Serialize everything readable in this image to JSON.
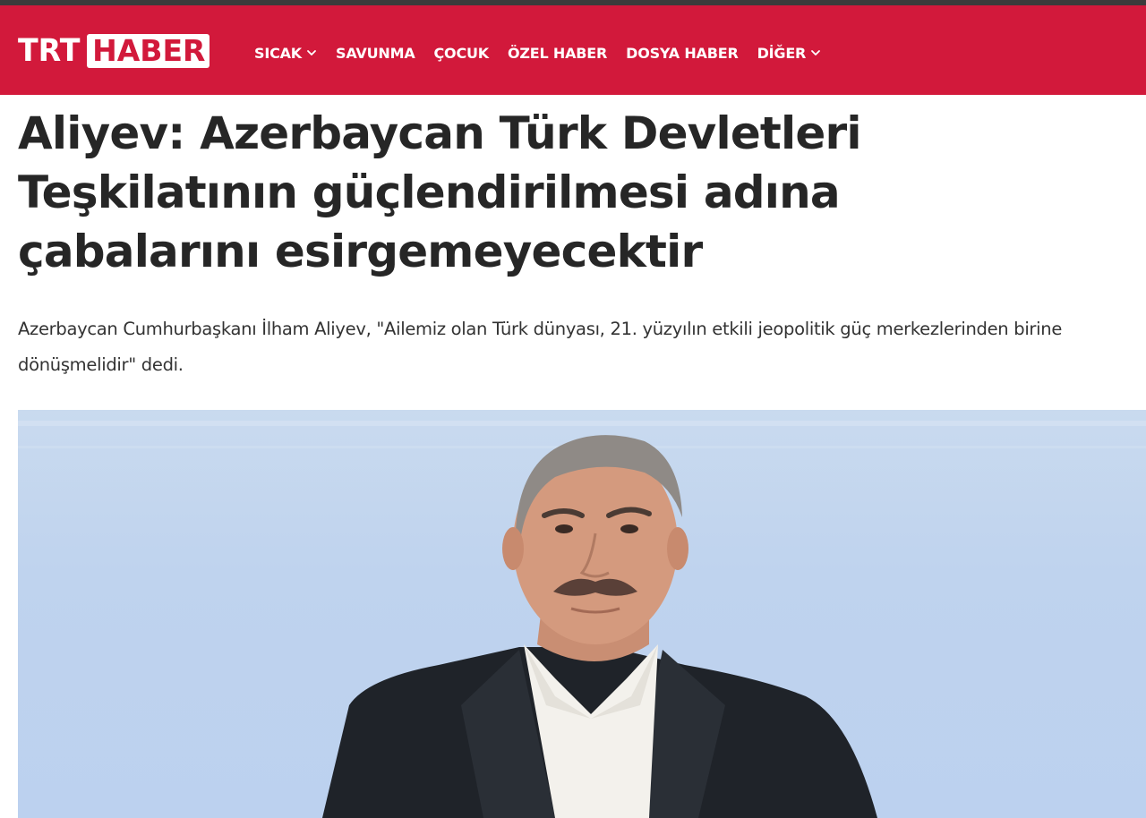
{
  "header": {
    "logo": {
      "part1": "TRT",
      "part2": "HABER"
    },
    "nav": [
      {
        "label": "SICAK",
        "has_dropdown": true
      },
      {
        "label": "SAVUNMA",
        "has_dropdown": false
      },
      {
        "label": "ÇOCUK",
        "has_dropdown": false
      },
      {
        "label": "ÖZEL HABER",
        "has_dropdown": false
      },
      {
        "label": "DOSYA HABER",
        "has_dropdown": false
      },
      {
        "label": "DİĞER",
        "has_dropdown": true
      }
    ]
  },
  "article": {
    "headline": "Aliyev: Azerbaycan Türk Devletleri Teşkilatının güçlendirilmesi adına çabalarını esirgemeyecektir",
    "summary": "Azerbaycan Cumhurbaşkanı İlham Aliyev, \"Ailemiz olan Türk dünyası, 21. yüzyılın etkili jeopolitik güç merkezlerinden birine dönüşmelidir\" dedi."
  },
  "colors": {
    "brand_red": "#d2193b",
    "text_dark": "#262626"
  },
  "icons": {
    "dropdown": "chevron-down-icon"
  }
}
